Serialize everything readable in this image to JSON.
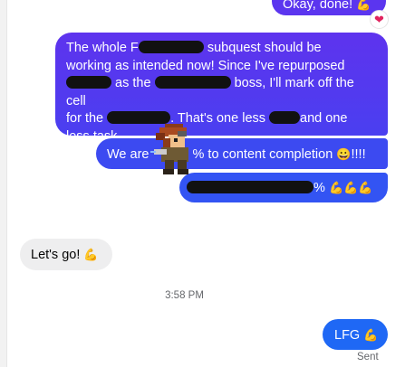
{
  "messages": {
    "m1": {
      "text": "Okay, done!",
      "emoji": "💪",
      "reaction": "❤"
    },
    "m2": {
      "line1a": "The whole F",
      "line1b": "subquest should be",
      "line2": "working as intended now! Since I've repurposed",
      "line3a": "as the",
      "line3b": "boss, I'll mark off the cell",
      "line4a": "for the",
      "line4b": ".  That's one less",
      "line4c": "and one",
      "line5": "less task."
    },
    "m3": {
      "prefix": "We are",
      "suffix": "% to content completion",
      "emoji": "😀",
      "trail": "!!!!"
    },
    "m4": {
      "suffix": "%",
      "emoji": "💪💪💪"
    },
    "m5": {
      "text": "Let's go!",
      "emoji": "💪"
    },
    "m6": {
      "text": "LFG",
      "emoji": "💪"
    }
  },
  "timestamp": "3:58 PM",
  "status": "Sent",
  "colors": {
    "outgoing_top": "#5e33ee",
    "outgoing_bottom": "#1f68f5",
    "incoming": "#eeeeef",
    "redaction": "#111111"
  },
  "icons": [
    "heart-reaction-icon",
    "flexed-biceps-emoji",
    "grinning-face-emoji",
    "pixel-character-sprite"
  ]
}
